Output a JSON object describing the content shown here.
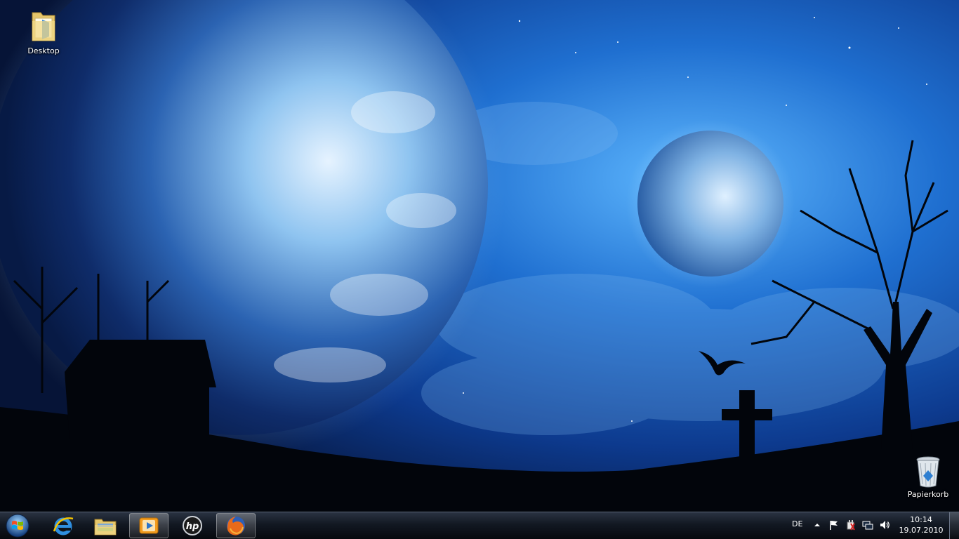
{
  "desktop": {
    "icons": [
      {
        "label": "Desktop",
        "icon": "folder-icon"
      },
      {
        "label": "Papierkorb",
        "icon": "recycle-bin-icon"
      }
    ]
  },
  "taskbar": {
    "start": {
      "icon": "windows-start-orb-icon"
    },
    "pinned": [
      {
        "name": "internet-explorer",
        "icon": "internet-explorer-icon",
        "active": false
      },
      {
        "name": "windows-explorer",
        "icon": "folder-library-icon",
        "active": false
      },
      {
        "name": "media-player",
        "icon": "media-player-icon",
        "active": true
      },
      {
        "name": "hp",
        "icon": "hp-icon",
        "active": false
      },
      {
        "name": "firefox",
        "icon": "firefox-icon",
        "active": true
      }
    ],
    "tray": {
      "language": "DE",
      "icons": [
        "show-hidden-icons-icon",
        "action-center-flag-icon",
        "power-icon",
        "network-icon",
        "volume-icon"
      ],
      "time": "10:14",
      "date": "19.07.2010"
    }
  }
}
